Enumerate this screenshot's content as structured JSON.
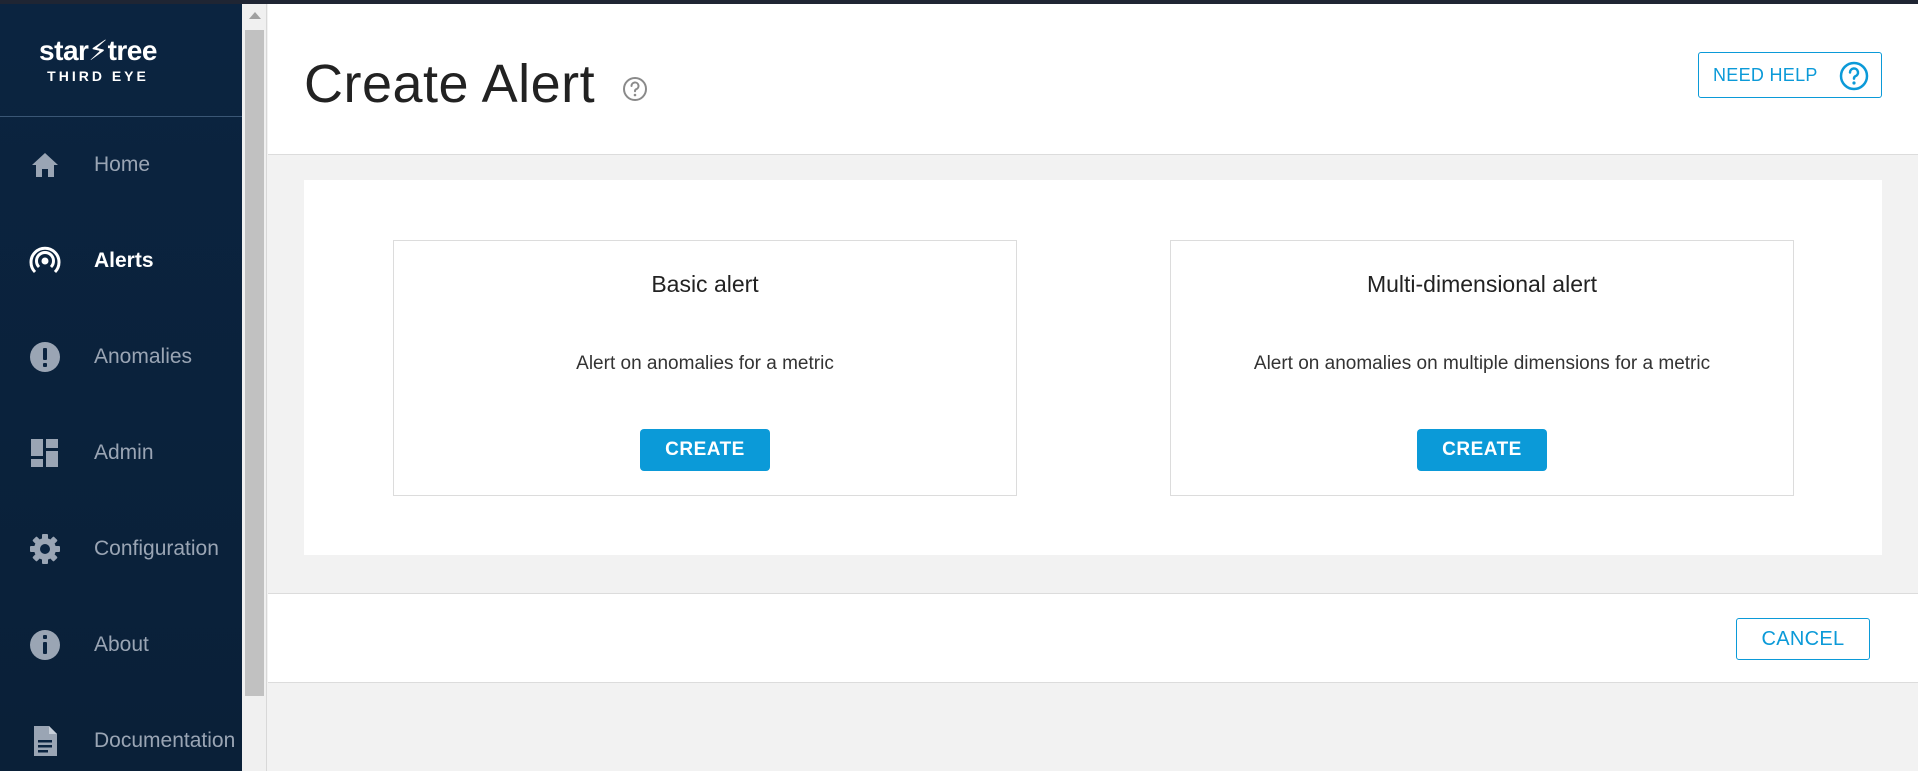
{
  "brand": {
    "name": "star⚡tree",
    "product": "THIRD EYE"
  },
  "sidebar": {
    "items": [
      {
        "label": "Home",
        "icon": "home-icon",
        "active": false
      },
      {
        "label": "Alerts",
        "icon": "alerts-broadcast-icon",
        "active": true
      },
      {
        "label": "Anomalies",
        "icon": "exclamation-circle-icon",
        "active": false
      },
      {
        "label": "Admin",
        "icon": "dashboard-grid-icon",
        "active": false
      },
      {
        "label": "Configuration",
        "icon": "gear-icon",
        "active": false
      },
      {
        "label": "About",
        "icon": "info-circle-icon",
        "active": false
      },
      {
        "label": "Documentation",
        "icon": "document-icon",
        "active": false
      }
    ]
  },
  "header": {
    "title": "Create Alert",
    "need_help_label": "NEED HELP"
  },
  "cards": [
    {
      "title": "Basic alert",
      "description": "Alert on anomalies for a metric",
      "button_label": "CREATE"
    },
    {
      "title": "Multi-dimensional alert",
      "description": "Alert on anomalies on multiple dimensions for a metric",
      "button_label": "CREATE"
    }
  ],
  "footer": {
    "cancel_label": "CANCEL"
  },
  "colors": {
    "accent": "#0b9ad8",
    "sidebar_bg": "#0b2440",
    "sidebar_text": "#9aa5b4",
    "active_text": "#ffffff"
  }
}
